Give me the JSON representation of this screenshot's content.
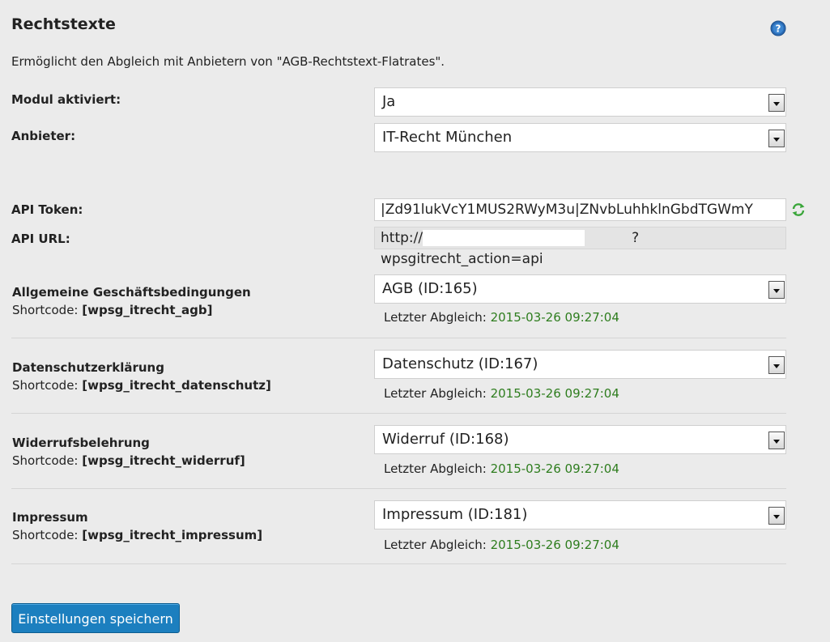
{
  "header": {
    "title": "Rechtstexte",
    "description": "Ermöglicht den Abgleich mit Anbietern von \"AGB-Rechtstext-Flatrates\"."
  },
  "module": {
    "label": "Modul aktiviert:",
    "value": "Ja"
  },
  "provider": {
    "label": "Anbieter:",
    "value": "IT-Recht München"
  },
  "api": {
    "token_label": "API Token:",
    "token_value": "|Zd91lukVcY1MUS2RWyM3u|ZNvbLuhhklnGbdTGWmY",
    "url_label": "API URL:",
    "url_prefix": "http://",
    "url_suffix": "?wpsgitrecht_action=api"
  },
  "shortcode_prefix": "Shortcode:",
  "sync_label": "Letzter Abgleich:",
  "documents": [
    {
      "title": "Allgemeine Geschäftsbedingungen",
      "shortcode": "[wpsg_itrecht_agb]",
      "selected": "AGB (ID:165)",
      "last_sync": "2015-03-26 09:27:04"
    },
    {
      "title": "Datenschutzerklärung",
      "shortcode": "[wpsg_itrecht_datenschutz]",
      "selected": "Datenschutz (ID:167)",
      "last_sync": "2015-03-26 09:27:04"
    },
    {
      "title": "Widerrufsbelehrung",
      "shortcode": "[wpsg_itrecht_widerruf]",
      "selected": "Widerruf (ID:168)",
      "last_sync": "2015-03-26 09:27:04"
    },
    {
      "title": "Impressum",
      "shortcode": "[wpsg_itrecht_impressum]",
      "selected": "Impressum (ID:181)",
      "last_sync": "2015-03-26 09:27:04"
    }
  ],
  "save_button": "Einstellungen speichern",
  "colors": {
    "date": "#2e7d1e",
    "button": "#1c7fbf",
    "help_icon": "#2a6bb5",
    "refresh_icon": "#3aa63a"
  }
}
